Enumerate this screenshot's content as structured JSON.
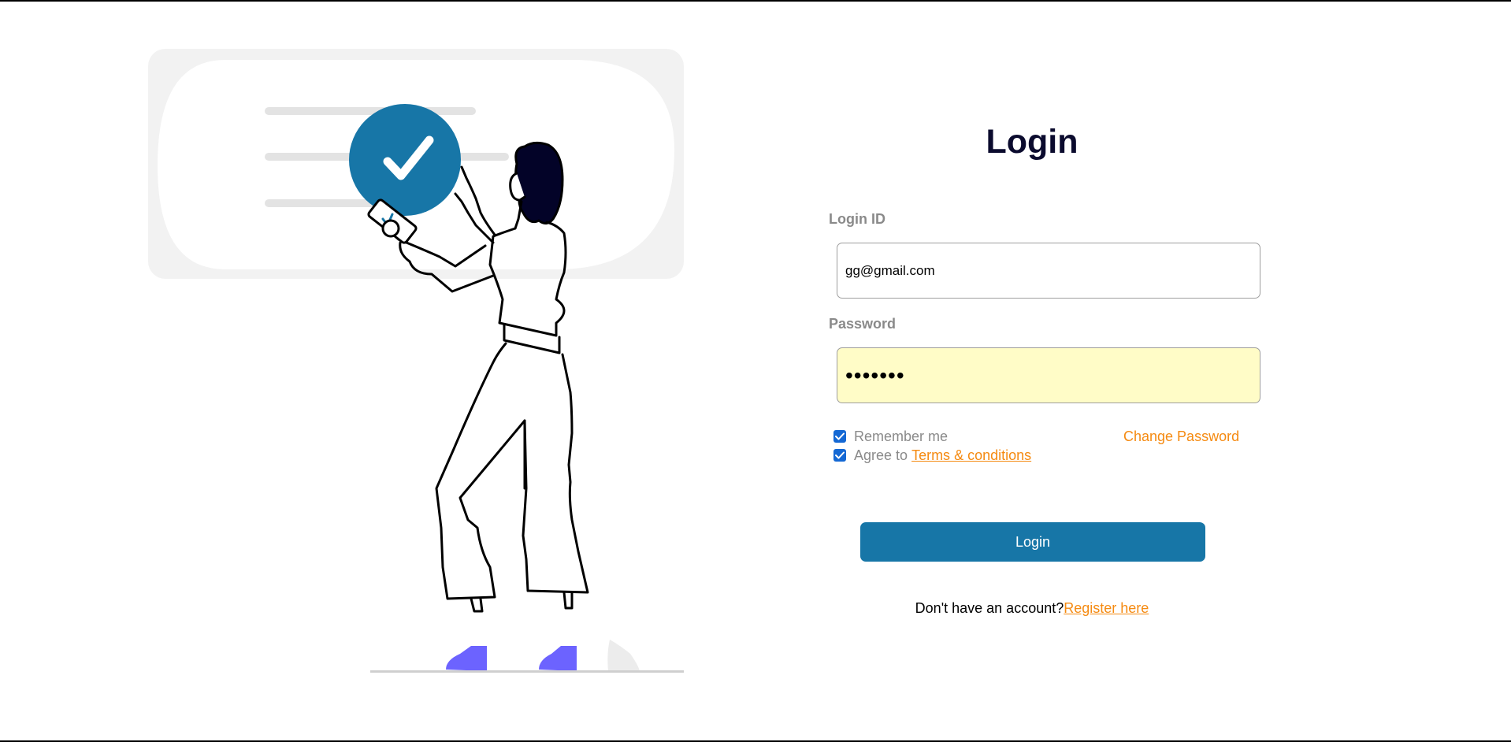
{
  "form": {
    "title": "Login",
    "login_id": {
      "label": "Login ID",
      "value": "gg@gmail.com"
    },
    "password": {
      "label": "Password",
      "value": "•••••••"
    },
    "remember_me": {
      "label": "Remember me",
      "checked": true
    },
    "agree": {
      "prefix": "Agree to",
      "link": "Terms & conditions",
      "checked": true
    },
    "change_password": "Change Password",
    "submit_label": "Login",
    "register": {
      "prompt": "Don't have an account?",
      "link": "Register here"
    }
  },
  "colors": {
    "accent": "#1776a7",
    "link": "#f58a11",
    "title": "#0b0b2e",
    "label": "#8a8a8a",
    "autofill_bg": "#fffcc7",
    "checkbox": "#1468d4",
    "shoes": "#6c63ff"
  },
  "illustration": {
    "icon": "check-circle-icon",
    "subject": "woman-with-phone"
  }
}
